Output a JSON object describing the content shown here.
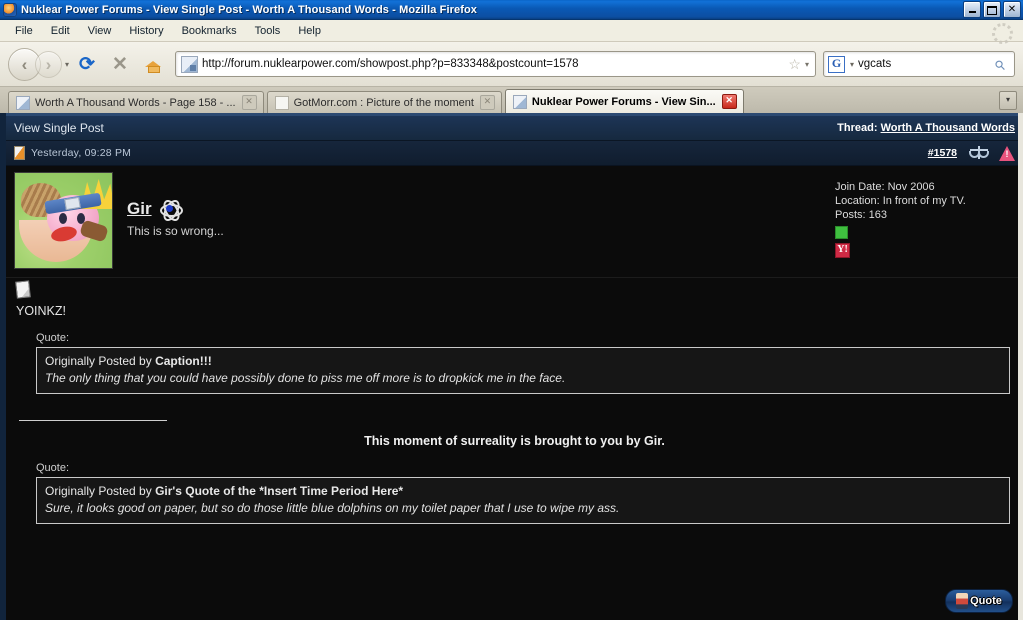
{
  "window": {
    "title": "Nuklear Power Forums - View Single Post - Worth A Thousand Words - Mozilla Firefox",
    "minimize_label": "_",
    "maximize_label": "",
    "close_label": "✕"
  },
  "menu": {
    "items": [
      {
        "label": "File"
      },
      {
        "label": "Edit"
      },
      {
        "label": "View"
      },
      {
        "label": "History"
      },
      {
        "label": "Bookmarks"
      },
      {
        "label": "Tools"
      },
      {
        "label": "Help"
      }
    ]
  },
  "toolbar": {
    "back_label": "‹",
    "forward_label": "›",
    "history_caret": "▾",
    "reload_label": "⟳",
    "stop_label": "✕",
    "home_name": "home-icon",
    "url": "http://forum.nuklearpower.com/showpost.php?p=833348&postcount=1578",
    "url_placeholder": "",
    "bookmark_star": "☆",
    "url_caret": "▾",
    "search_engine_letter": "G",
    "search_engine_caret": "▾",
    "search_value": "vgcats",
    "search_placeholder": "",
    "search_icon": "magnifier-icon"
  },
  "tabs": {
    "items": [
      {
        "label": "Worth A Thousand Words - Page 158 - ...",
        "close": "✕",
        "active": false
      },
      {
        "label": "GotMorr.com : Picture of the moment",
        "close": "✕",
        "active": false
      },
      {
        "label": "Nuklear Power Forums - View Sin...",
        "close": "✕",
        "active": true
      }
    ],
    "list_all_label": "▾"
  },
  "forum": {
    "header": {
      "page_title": "View Single Post",
      "thread_label": "Thread:",
      "thread_name": "Worth A Thousand Words"
    },
    "post_header": {
      "date": "Yesterday, 09:28 PM",
      "post_number": "#1578",
      "scales_icon": "scales-icon",
      "warning_icon": "warning-icon"
    },
    "user": {
      "name": "Gir",
      "title": "This is so wrong...",
      "rank_icon": "atom-icon",
      "join_date": "Join Date: Nov 2006",
      "location": "Location: In front of my TV.",
      "posts": "Posts: 163",
      "online_status_icon": "green-square-icon",
      "messenger_icon": "yahoo-messenger-icon",
      "messenger_letter": "Y!"
    },
    "post": {
      "attachment_icon": "page-icon",
      "text": "YOINKZ!",
      "quote_label_1": "Quote:",
      "quote1_attrib_prefix": "Originally Posted by",
      "quote1_author": "Caption!!!",
      "quote1_text": "The only thing that you could have possibly done to piss me off more is to dropkick me in the face.",
      "signature_text": "This moment of surreality is brought to you by Gir.",
      "quote_label_2": "Quote:",
      "quote2_attrib_prefix": "Originally Posted by",
      "quote2_author": "Gir's Quote of the *Insert Time Period Here*",
      "quote2_text": "Sure, it looks good on paper, but so do those little blue dolphins on my toilet paper that I use to wipe my ass."
    },
    "actions": {
      "quote_button": "Quote"
    }
  }
}
